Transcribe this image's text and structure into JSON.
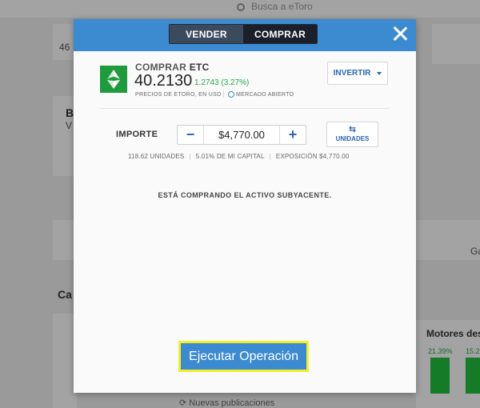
{
  "background": {
    "search_placeholder": "Busca a eToro",
    "partial_texts": [
      "46",
      "B",
      "V",
      "Ca",
      "Ga",
      "Motores dest",
      "21.39%",
      "15.2"
    ],
    "bottom_link": "Nuevas publicaciones"
  },
  "modal": {
    "tabs": {
      "sell": "VENDER",
      "buy": "COMPRAR"
    },
    "active_tab": "sell",
    "asset": {
      "action": "COMPRAR",
      "symbol": "ETC",
      "price": "40.2130",
      "change": "1.2743 (3.27%)",
      "meta_prices": "PRECIOS DE ETORO, EN USD",
      "meta_market": "MERCADO ABIERTO",
      "logo_color": "#1f9a3c"
    },
    "invest_button": "INVERTIR",
    "amount": {
      "label": "IMPORTE",
      "value": "$4,770.00",
      "minus": "−",
      "plus": "+",
      "units_button": "UNIDADES"
    },
    "stats": {
      "units": "118.62 UNIDADES",
      "capital": "5.01% DE MI CAPITAL",
      "exposure": "EXPOSICIÓN $4,770.00"
    },
    "notice": "ESTÁ COMPRANDO EL ACTIVO SUBYACENTE.",
    "execute_button": "Ejecutar Operación",
    "colors": {
      "header": "#3c8ad0",
      "accent": "#2a65b0",
      "positive": "#22a84a",
      "highlight": "#f5ef2a"
    }
  }
}
